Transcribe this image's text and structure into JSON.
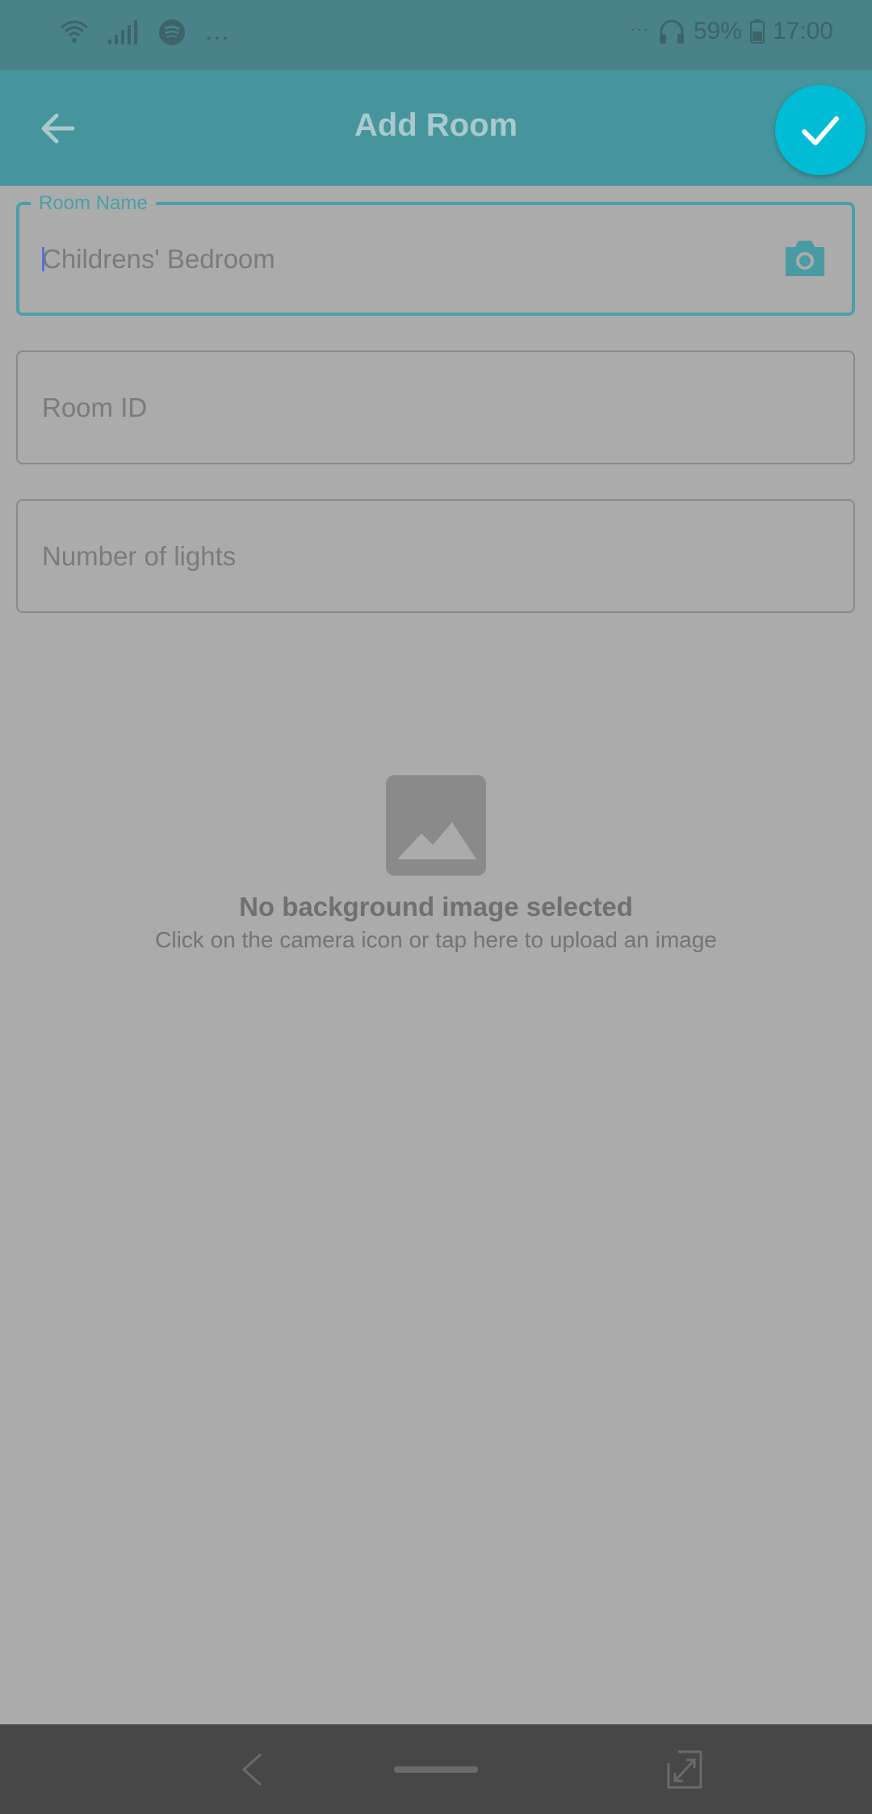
{
  "status_bar": {
    "battery_percent": "59%",
    "time": "17:00",
    "left_icons": [
      "wifi-icon",
      "signal-icon",
      "spotify-icon"
    ],
    "left_dots": "...",
    "right_dots": "...",
    "right_icons": [
      "headphones-icon",
      "battery-icon"
    ]
  },
  "app_bar": {
    "title": "Add Room",
    "back_icon": "arrow-left-icon",
    "confirm_icon": "check-icon"
  },
  "form": {
    "room_name": {
      "label": "Room Name",
      "value": "Childrens' Bedroom",
      "icon": "camera-icon"
    },
    "room_id": {
      "placeholder": "Room ID"
    },
    "num_lights": {
      "placeholder": "Number of lights"
    }
  },
  "empty_state": {
    "icon": "image-icon",
    "title": "No background image selected",
    "subtitle": "Click on the camera icon or tap here to upload an image"
  },
  "nav_bar": {
    "icons": [
      "nav-back-icon",
      "home-bar",
      "rotate-icon"
    ]
  },
  "colors": {
    "status_bar": "#4a8289",
    "app_bar": "#46959d",
    "accent": "#4aa0a9",
    "fab": "#00bcd4",
    "background": "#ababab",
    "nav_bar": "#474747"
  }
}
